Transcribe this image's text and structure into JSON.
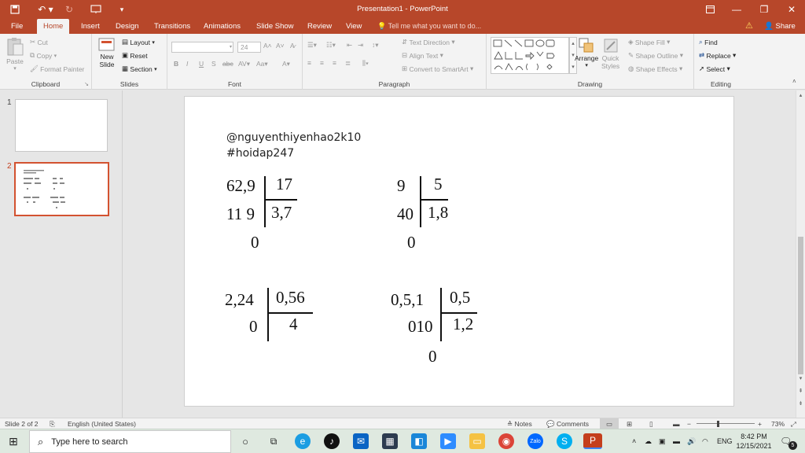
{
  "window": {
    "title": "Presentation1 - PowerPoint",
    "share_label": "Share"
  },
  "tabs": [
    {
      "label": "File"
    },
    {
      "label": "Home"
    },
    {
      "label": "Insert"
    },
    {
      "label": "Design"
    },
    {
      "label": "Transitions"
    },
    {
      "label": "Animations"
    },
    {
      "label": "Slide Show"
    },
    {
      "label": "Review"
    },
    {
      "label": "View"
    }
  ],
  "tell_me": "Tell me what you want to do...",
  "ribbon": {
    "clipboard": {
      "paste": "Paste",
      "cut": "Cut",
      "copy": "Copy",
      "format_painter": "Format Painter",
      "label": "Clipboard"
    },
    "slides": {
      "new_slide_line1": "New",
      "new_slide_line2": "Slide",
      "layout": "Layout",
      "reset": "Reset",
      "section": "Section",
      "label": "Slides"
    },
    "font": {
      "font_name": "",
      "font_size": "24",
      "label": "Font"
    },
    "paragraph": {
      "text_direction": "Text Direction",
      "align_text": "Align Text",
      "convert_smartart": "Convert to SmartArt",
      "label": "Paragraph"
    },
    "drawing": {
      "arrange": "Arrange",
      "quick_styles_line1": "Quick",
      "quick_styles_line2": "Styles",
      "shape_fill": "Shape Fill",
      "shape_outline": "Shape Outline",
      "shape_effects": "Shape Effects",
      "label": "Drawing"
    },
    "editing": {
      "find": "Find",
      "replace": "Replace",
      "select": "Select",
      "label": "Editing"
    }
  },
  "slides_panel": [
    {
      "number": "1"
    },
    {
      "number": "2"
    }
  ],
  "slide_content": {
    "handle": "@nguyenthiyenhao2k10",
    "hashtag": "#hoidap247",
    "div1": {
      "dividend": "62,9",
      "divisor": "17",
      "remainder": "11 9",
      "quotient": "3,7",
      "final": "0"
    },
    "div2": {
      "dividend": "9",
      "divisor": "5",
      "remainder": "40",
      "quotient": "1,8",
      "final": "0"
    },
    "div3": {
      "dividend": "2,24",
      "divisor": "0,56",
      "remainder": "0",
      "quotient": "4"
    },
    "div4": {
      "dividend": "0,5,1",
      "divisor": "0,5",
      "remainder": "010",
      "quotient": "1,2",
      "final": "0"
    }
  },
  "statusbar": {
    "slide_info": "Slide 2 of 2",
    "language": "English (United States)",
    "notes": "Notes",
    "comments": "Comments",
    "zoom": "73%"
  },
  "taskbar": {
    "search_placeholder": "Type here to search",
    "lang": "ENG",
    "time": "8:42 PM",
    "date": "12/15/2021",
    "notifications": "5"
  },
  "colors": {
    "accent": "#b7472a",
    "ribbon_bg": "#f3f3f3",
    "active_thumb_border": "#d35230"
  }
}
